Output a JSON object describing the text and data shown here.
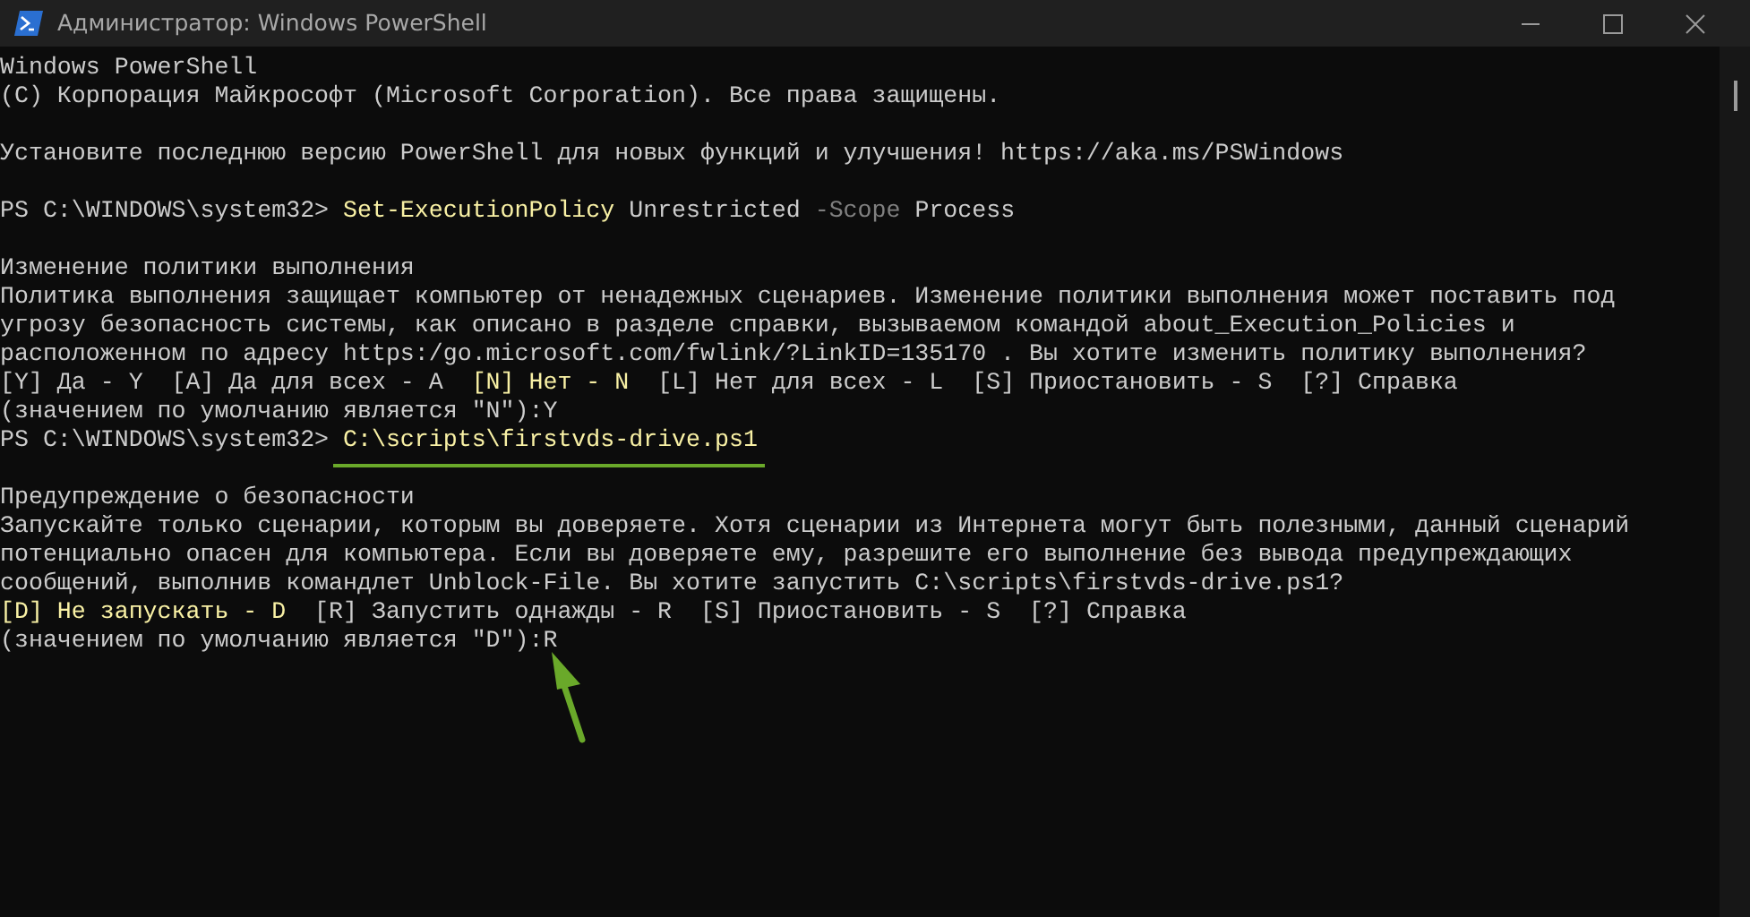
{
  "window": {
    "title": "Администратор: Windows PowerShell"
  },
  "terminal": {
    "lines": [
      {
        "kind": "text",
        "segments": [
          {
            "text": "Windows PowerShell",
            "kind": "output"
          }
        ]
      },
      {
        "kind": "text",
        "segments": [
          {
            "text": "(C) Корпорация Майкрософт (Microsoft Corporation). Все права защищены.",
            "kind": "output"
          }
        ]
      },
      {
        "kind": "blank"
      },
      {
        "kind": "text",
        "segments": [
          {
            "text": "Установите последнюю версию PowerShell для новых функций и улучшения! https://aka.ms/PSWindows",
            "kind": "output"
          }
        ]
      },
      {
        "kind": "blank"
      },
      {
        "kind": "text",
        "segments": [
          {
            "text": "PS C:\\WINDOWS\\system32> ",
            "kind": "output"
          },
          {
            "text": "Set-ExecutionPolicy",
            "kind": "command"
          },
          {
            "text": " Unrestricted ",
            "kind": "output"
          },
          {
            "text": "-Scope",
            "kind": "parameter"
          },
          {
            "text": " Process",
            "kind": "output"
          }
        ]
      },
      {
        "kind": "blank"
      },
      {
        "kind": "text",
        "segments": [
          {
            "text": "Изменение политики выполнения",
            "kind": "output"
          }
        ]
      },
      {
        "kind": "text",
        "segments": [
          {
            "text": "Политика выполнения защищает компьютер от ненадежных сценариев. Изменение политики выполнения может поставить под",
            "kind": "output"
          }
        ]
      },
      {
        "kind": "text",
        "segments": [
          {
            "text": "угрозу безопасность системы, как описано в разделе справки, вызываемом командой about_Execution_Policies и",
            "kind": "output"
          }
        ]
      },
      {
        "kind": "text",
        "segments": [
          {
            "text": "расположенном по адресу https:/go.microsoft.com/fwlink/?LinkID=135170 . Вы хотите изменить политику выполнения?",
            "kind": "output"
          }
        ]
      },
      {
        "kind": "text",
        "segments": [
          {
            "text": "[Y] Да - Y  [A] Да для всех - A  ",
            "kind": "output"
          },
          {
            "text": "[N] Нет - N",
            "kind": "highlight"
          },
          {
            "text": "  [L] Нет для всех - L  [S] Приостановить - S  [?] Справка",
            "kind": "output"
          }
        ]
      },
      {
        "kind": "text",
        "segments": [
          {
            "text": "(значением по умолчанию является \"N\"):Y",
            "kind": "output"
          }
        ]
      },
      {
        "kind": "text",
        "segments": [
          {
            "text": "PS C:\\WINDOWS\\system32> ",
            "kind": "output"
          },
          {
            "text": "C:\\scripts\\firstvds-drive.ps1",
            "kind": "command",
            "underlined": true
          }
        ]
      },
      {
        "kind": "blank"
      },
      {
        "kind": "text",
        "segments": [
          {
            "text": "Предупреждение о безопасности",
            "kind": "output"
          }
        ]
      },
      {
        "kind": "text",
        "segments": [
          {
            "text": "Запускайте только сценарии, которым вы доверяете. Хотя сценарии из Интернета могут быть полезными, данный сценарий",
            "kind": "output"
          }
        ]
      },
      {
        "kind": "text",
        "segments": [
          {
            "text": "потенциально опасен для компьютера. Если вы доверяете ему, разрешите его выполнение без вывода предупреждающих",
            "kind": "output"
          }
        ]
      },
      {
        "kind": "text",
        "segments": [
          {
            "text": "сообщений, выполнив командлет Unblock-File. Вы хотите запустить C:\\scripts\\firstvds-drive.ps1?",
            "kind": "output"
          }
        ]
      },
      {
        "kind": "text",
        "segments": [
          {
            "text": "[D] Не запускать - D",
            "kind": "highlight"
          },
          {
            "text": "  [R] Запустить однажды - R  [S] Приостановить - S  [?] Справка",
            "kind": "output"
          }
        ]
      },
      {
        "kind": "text",
        "pointer_arrow": true,
        "segments": [
          {
            "text": "(значением по умолчанию является \"D\"):R",
            "kind": "output"
          }
        ]
      }
    ]
  }
}
